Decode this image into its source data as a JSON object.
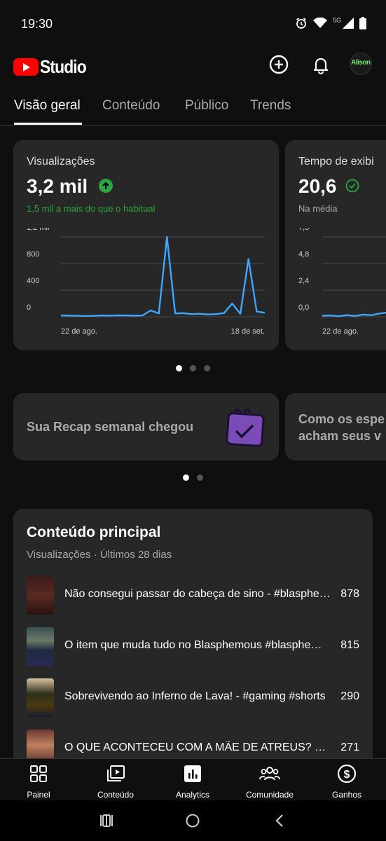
{
  "status_bar": {
    "time": "19:30",
    "network": "5G"
  },
  "header": {
    "brand": "Studio",
    "avatar_text": "Alison"
  },
  "tabs": [
    {
      "label": "Visão geral",
      "active": true
    },
    {
      "label": "Conteúdo",
      "active": false
    },
    {
      "label": "Público",
      "active": false
    },
    {
      "label": "Trends",
      "active": false
    }
  ],
  "metric_cards": [
    {
      "label": "Visualizações",
      "value": "3,2 mil",
      "note": "1,5 mil a mais do que o habitual",
      "note_color": "#2ba640",
      "chart_data": {
        "type": "line",
        "y_ticks": [
          "1,2 mil",
          "800",
          "400",
          "0"
        ],
        "ylim": [
          0,
          1200
        ],
        "x_labels": [
          "22 de ago.",
          "18 de set."
        ],
        "values": [
          20,
          18,
          15,
          12,
          15,
          20,
          18,
          22,
          20,
          18,
          20,
          95,
          50,
          1200,
          50,
          55,
          40,
          45,
          35,
          40,
          55,
          200,
          45,
          870,
          80,
          60
        ],
        "color": "#3ea6ff"
      }
    },
    {
      "label": "Tempo de exibi",
      "value": "20,6",
      "note": "Na média",
      "note_color": "#aaaaaa",
      "chart_data": {
        "type": "line",
        "y_ticks": [
          "7,3",
          "4,8",
          "2,4",
          "0,0"
        ],
        "ylim": [
          0,
          7.3
        ],
        "x_labels": [
          "22 de ago."
        ],
        "values": [
          0.1,
          0.12,
          0.05,
          0.15,
          0.08,
          0.2,
          0.15,
          0.3,
          0.4,
          0.55,
          0.75
        ],
        "color": "#3ea6ff"
      }
    }
  ],
  "recap_cards": [
    {
      "text": "Sua Recap semanal chegou"
    },
    {
      "text_line1": "Como os espe",
      "text_line2": "acham seus v"
    }
  ],
  "top_content": {
    "title": "Conteúdo principal",
    "subtitle": "Visualizações · Últimos 28 dias",
    "rows": [
      {
        "title": "Não consegui passar do cabeça de sino - #blasphemous",
        "views": "878"
      },
      {
        "title": "O item que muda tudo no Blasphemous #blasphemous",
        "views": "815"
      },
      {
        "title": "Sobrevivendo ao Inferno de Lava! - #gaming #shorts",
        "views": "290"
      },
      {
        "title": "O QUE ACONTECEU COM A MÃE DE ATREUS? #godofwar",
        "views": "271"
      }
    ]
  },
  "bottom_nav": [
    {
      "label": "Painel",
      "icon": "dashboard-icon"
    },
    {
      "label": "Conteúdo",
      "icon": "content-icon"
    },
    {
      "label": "Analytics",
      "icon": "analytics-icon"
    },
    {
      "label": "Comunidade",
      "icon": "community-icon"
    },
    {
      "label": "Ganhos",
      "icon": "earnings-icon"
    }
  ]
}
